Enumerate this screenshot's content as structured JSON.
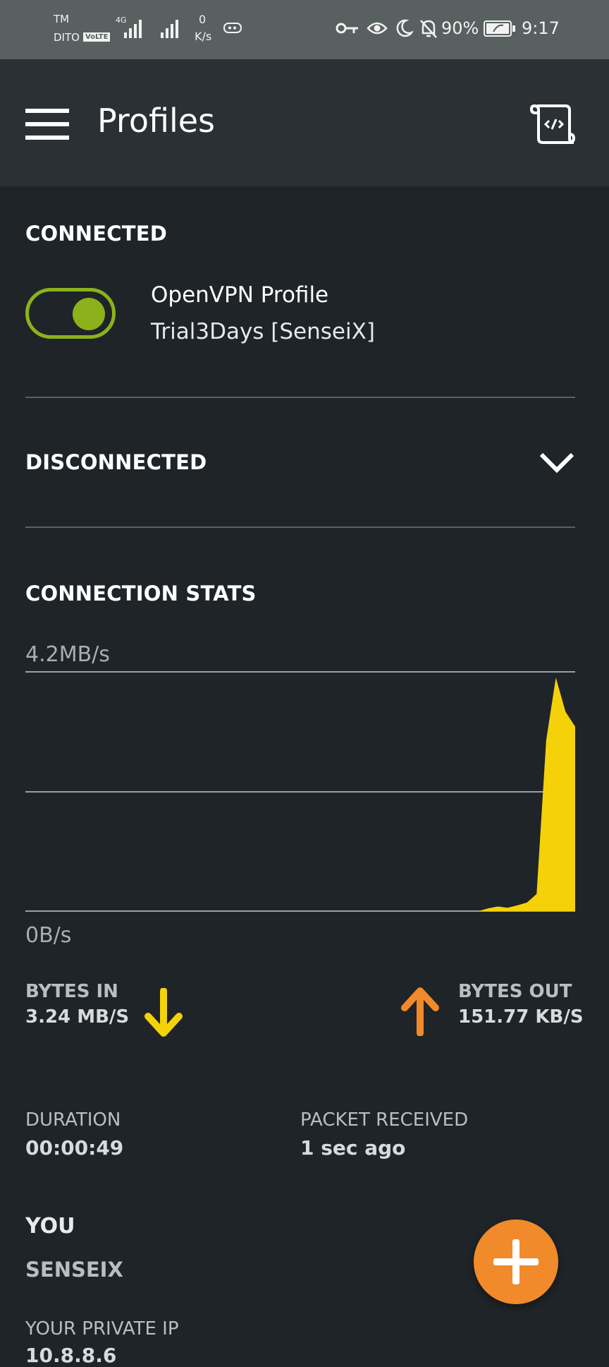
{
  "status_bar": {
    "carrier_top": "TM",
    "carrier_bottom": "DITO",
    "volte": "VoLTE",
    "network": "4G",
    "speed_value": "0",
    "speed_unit": "K/s",
    "battery": "90%",
    "time": "9:17"
  },
  "app_bar": {
    "title": "Profiles"
  },
  "connected": {
    "heading": "CONNECTED",
    "profile_name": "OpenVPN Profile",
    "profile_subtitle": "Trial3Days [SenseiX]",
    "toggle_on": true
  },
  "disconnected": {
    "heading": "DISCONNECTED"
  },
  "stats": {
    "heading": "CONNECTION STATS",
    "bytes_in_label": "BYTES IN",
    "bytes_in_value": "3.24 MB/S",
    "bytes_out_label": "BYTES OUT",
    "bytes_out_value": "151.77 KB/S",
    "duration_label": "DURATION",
    "duration_value": "00:00:49",
    "packet_label": "PACKET RECEIVED",
    "packet_value": "1 sec ago"
  },
  "you": {
    "heading": "YOU",
    "value": "SENSEIX",
    "private_ip_label": "YOUR PRIVATE IP",
    "private_ip_value": "10.8.8.6"
  },
  "colors": {
    "accent_green": "#8bb21b",
    "bytes_in": "#f5d10a",
    "bytes_out": "#f18a2a",
    "fab": "#f18a2a"
  },
  "chart_data": {
    "type": "area",
    "ylim_labels": [
      "0B/s",
      "4.2MB/s"
    ],
    "y_top_label": "4.2MB/s",
    "y_bottom_label": "0B/s",
    "ylim": [
      0,
      4.2
    ],
    "unit": "MB/s",
    "grid": true,
    "series": [
      {
        "values": [
          0,
          0,
          0,
          0,
          0,
          0,
          0,
          0,
          0,
          0,
          0,
          0,
          0,
          0,
          0,
          0,
          0,
          0,
          0,
          0,
          0,
          0,
          0,
          0,
          0,
          0,
          0,
          0,
          0,
          0,
          0,
          0,
          0,
          0,
          0,
          0,
          0,
          0,
          0,
          0,
          0,
          0,
          0,
          0,
          0,
          0,
          0,
          0,
          0.05,
          0.08,
          0.06,
          0.1,
          0.15,
          0.3,
          3.0,
          4.1,
          3.5,
          3.24
        ]
      }
    ]
  }
}
